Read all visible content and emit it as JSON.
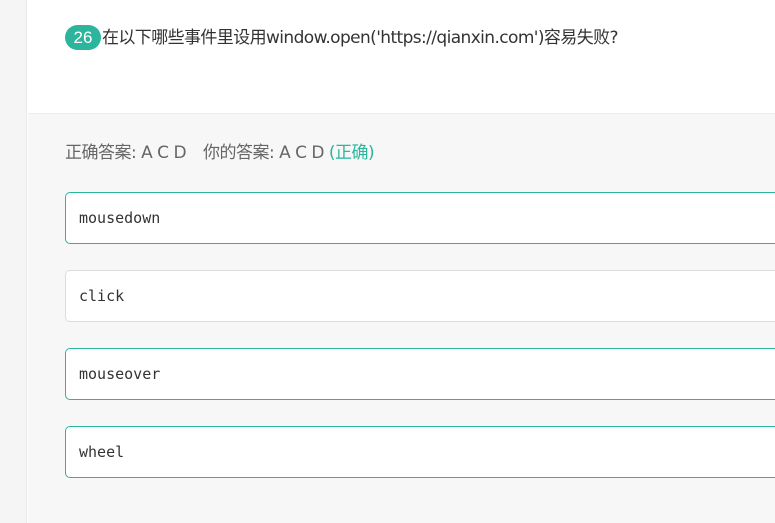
{
  "question": {
    "number": "26",
    "text": "在以下哪些事件里设用window.open('https://qianxin.com')容易失败?"
  },
  "result": {
    "correct_label": "正确答案:",
    "correct_answer": "A C D",
    "your_label": "你的答案:",
    "your_answer": "A C D",
    "status": "(正确)"
  },
  "options": [
    {
      "text": "mousedown",
      "selected": true
    },
    {
      "text": "click",
      "selected": false
    },
    {
      "text": "mouseover",
      "selected": true
    },
    {
      "text": "wheel",
      "selected": true
    }
  ],
  "colors": {
    "accent": "#2bb59c",
    "text": "#333333",
    "muted": "#666666",
    "unselected_border": "#dcdcdc"
  }
}
